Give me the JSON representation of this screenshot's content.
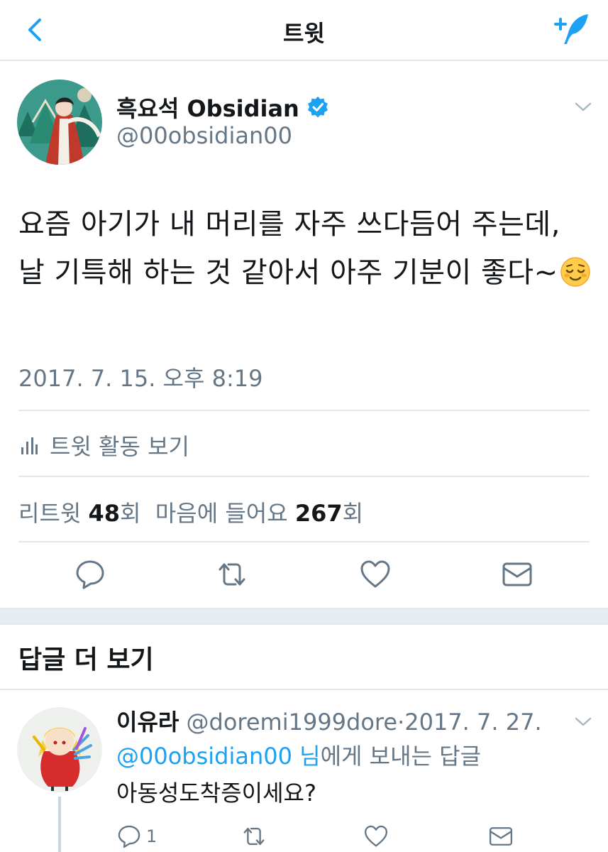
{
  "nav": {
    "title": "트윗"
  },
  "tweet": {
    "name": "흑요석 Obsidian",
    "handle": "@00obsidian00",
    "text": "요즘 아기가 내 머리를 자주 쓰다듬어 주는데, 날 기특해 하는 것 같아서 아주 기분이 좋다~",
    "emoji": "relieved-face-emoji",
    "timestamp": "2017. 7. 15. 오후 8:19",
    "activity_label": "트윗 활동 보기",
    "retweets_label": "리트윗",
    "retweets_count": "48",
    "retweets_unit": "회",
    "likes_label": "마음에 들어요",
    "likes_count": "267",
    "likes_unit": "회"
  },
  "more_replies": {
    "title": "답글 더 보기"
  },
  "reply": {
    "name": "이유라",
    "handle": "@doremi1999dore",
    "separator": "·",
    "date": "2017. 7. 27.",
    "reply_to_mention": "@00obsidian00 님",
    "reply_to_suffix": "에게 보내는 답글",
    "text": "아동성도착증이세요?",
    "reply_count": "1"
  },
  "colors": {
    "accent": "#1da1f2",
    "text": "#14171a",
    "secondary": "#657786",
    "divider": "#e1e8ed",
    "verified": "#1da1f2"
  }
}
